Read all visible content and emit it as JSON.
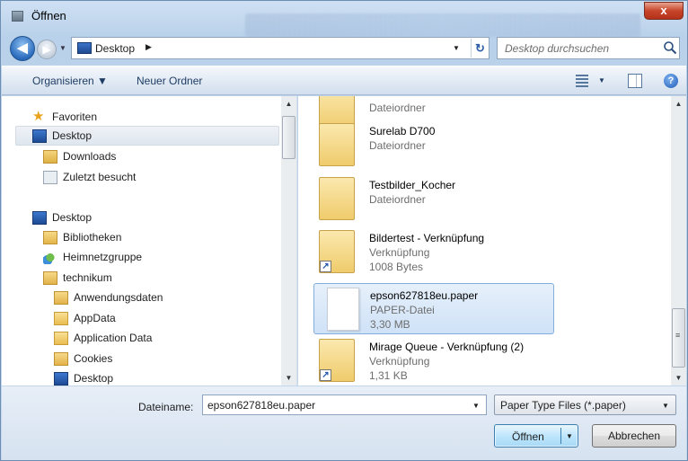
{
  "title": "Öffnen",
  "close_glyph": "x",
  "nav": {
    "back_glyph": "◀",
    "fwd_glyph": "▶",
    "hist_drop": "▼",
    "address": "Desktop",
    "address_chevron": "▶",
    "address_drop": "▼",
    "refresh_glyph": "↻",
    "search_placeholder": "Desktop durchsuchen"
  },
  "toolbar": {
    "organize": "Organisieren ▼",
    "new_folder": "Neuer Ordner",
    "view_drop": "▼",
    "help_glyph": "?"
  },
  "sidebar": {
    "items": [
      {
        "label": "Favoriten",
        "icon": "star-icon"
      },
      {
        "label": "Desktop",
        "icon": "desktop-icon"
      },
      {
        "label": "Downloads",
        "icon": "downloads-icon"
      },
      {
        "label": "Zuletzt besucht",
        "icon": "recent-places-icon"
      },
      {
        "label": "Desktop",
        "icon": "desktop-icon"
      },
      {
        "label": "Bibliotheken",
        "icon": "libraries-icon"
      },
      {
        "label": "Heimnetzgruppe",
        "icon": "homegroup-icon"
      },
      {
        "label": "technikum",
        "icon": "user-folder-icon"
      },
      {
        "label": "Anwendungsdaten",
        "icon": "shortcut-folder-icon"
      },
      {
        "label": "AppData",
        "icon": "folder-icon"
      },
      {
        "label": "Application Data",
        "icon": "folder-icon"
      },
      {
        "label": "Cookies",
        "icon": "shortcut-folder-icon"
      },
      {
        "label": "Desktop",
        "icon": "desktop-icon"
      }
    ],
    "selected_index": 1
  },
  "files": [
    {
      "name": "",
      "line1": "Dateiordner",
      "line2": ""
    },
    {
      "name": "Surelab D700",
      "line1": "Dateiordner",
      "line2": ""
    },
    {
      "name": "Testbilder_Kocher",
      "line1": "Dateiordner",
      "line2": ""
    },
    {
      "name": "Bildertest - Verknüpfung",
      "line1": "Verknüpfung",
      "line2": "1008 Bytes"
    },
    {
      "name": "epson627818eu.paper",
      "line1": "PAPER-Datei",
      "line2": "3,30 MB"
    },
    {
      "name": "Mirage Queue - Verknüpfung (2)",
      "line1": "Verknüpfung",
      "line2": "1,31 KB"
    }
  ],
  "selected_file_index": 4,
  "scroll": {
    "up": "▲",
    "down": "▼",
    "grip": "≡"
  },
  "bottom": {
    "filename_label": "Dateiname:",
    "filename_value": "epson627818eu.paper",
    "filename_drop": "▼",
    "filetype": "Paper Type Files (*.paper)",
    "filetype_drop": "▼",
    "open": "Öffnen",
    "open_drop": "▼",
    "cancel": "Abbrechen"
  },
  "colors": {
    "selection": "#cfe2f7",
    "accent": "#3c7fb1",
    "close": "#c6452b"
  }
}
